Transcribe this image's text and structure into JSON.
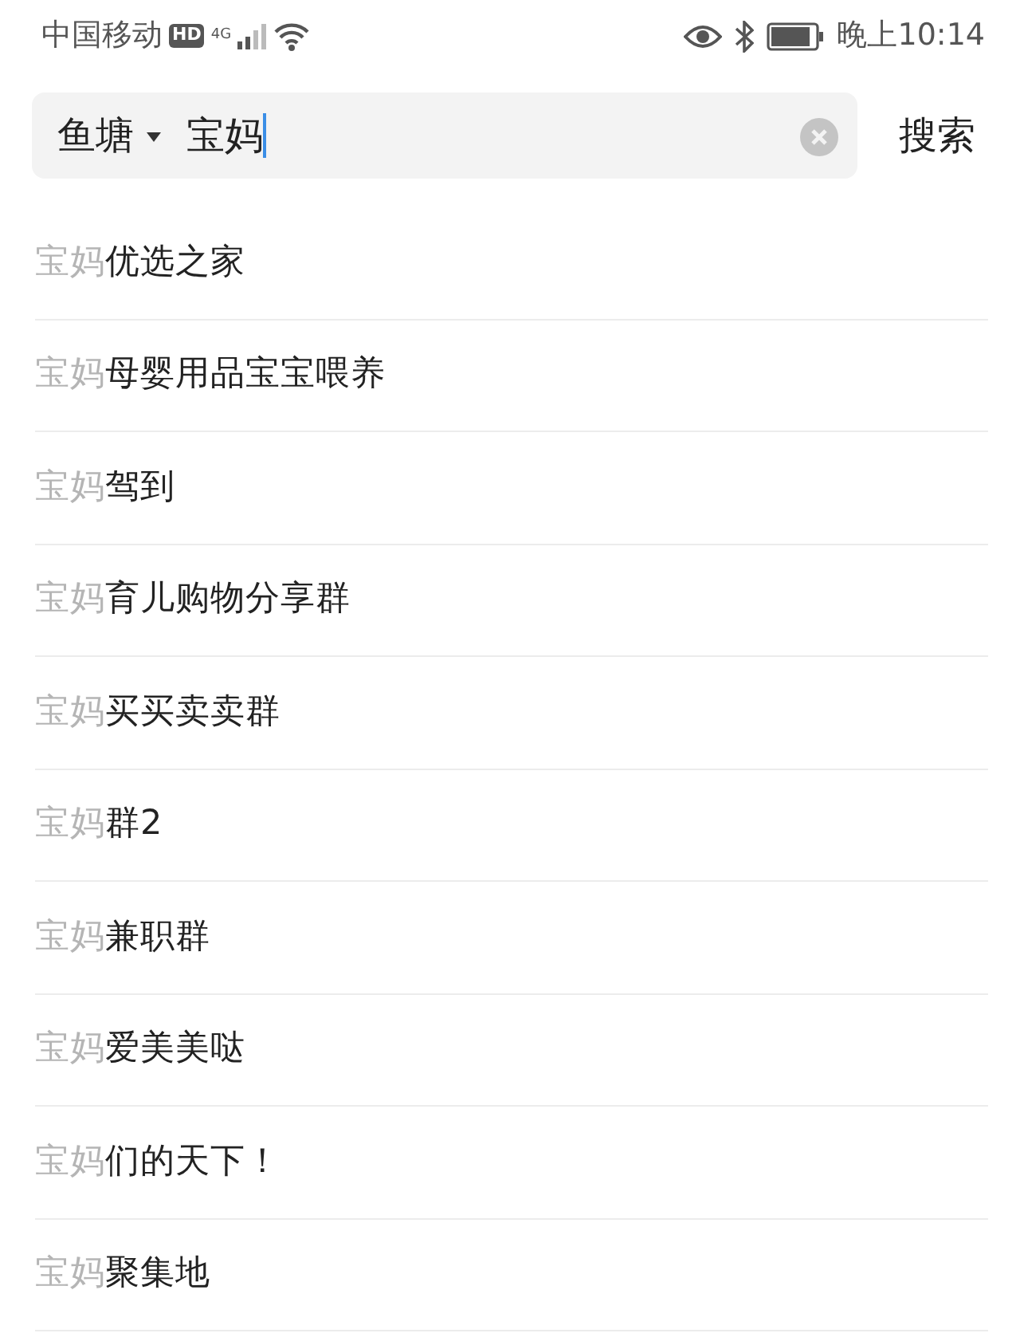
{
  "status_bar": {
    "carrier": "中国移动",
    "hd": "HD",
    "network": "4G",
    "time": "晚上10:14"
  },
  "search": {
    "scope": "鱼塘",
    "query": "宝妈",
    "button": "搜索"
  },
  "suggestions": [
    {
      "prefix": "宝妈",
      "rest": "优选之家"
    },
    {
      "prefix": "宝妈",
      "rest": "母婴用品宝宝喂养"
    },
    {
      "prefix": "宝妈",
      "rest": "驾到"
    },
    {
      "prefix": "宝妈",
      "rest": "育儿购物分享群"
    },
    {
      "prefix": "宝妈",
      "rest": "买买卖卖群"
    },
    {
      "prefix": "宝妈",
      "rest": "群2"
    },
    {
      "prefix": "宝妈",
      "rest": "兼职群"
    },
    {
      "prefix": "宝妈",
      "rest": "爱美美哒"
    },
    {
      "prefix": "宝妈",
      "rest": "们的天下！"
    },
    {
      "prefix": "宝妈",
      "rest": "聚集地"
    }
  ]
}
